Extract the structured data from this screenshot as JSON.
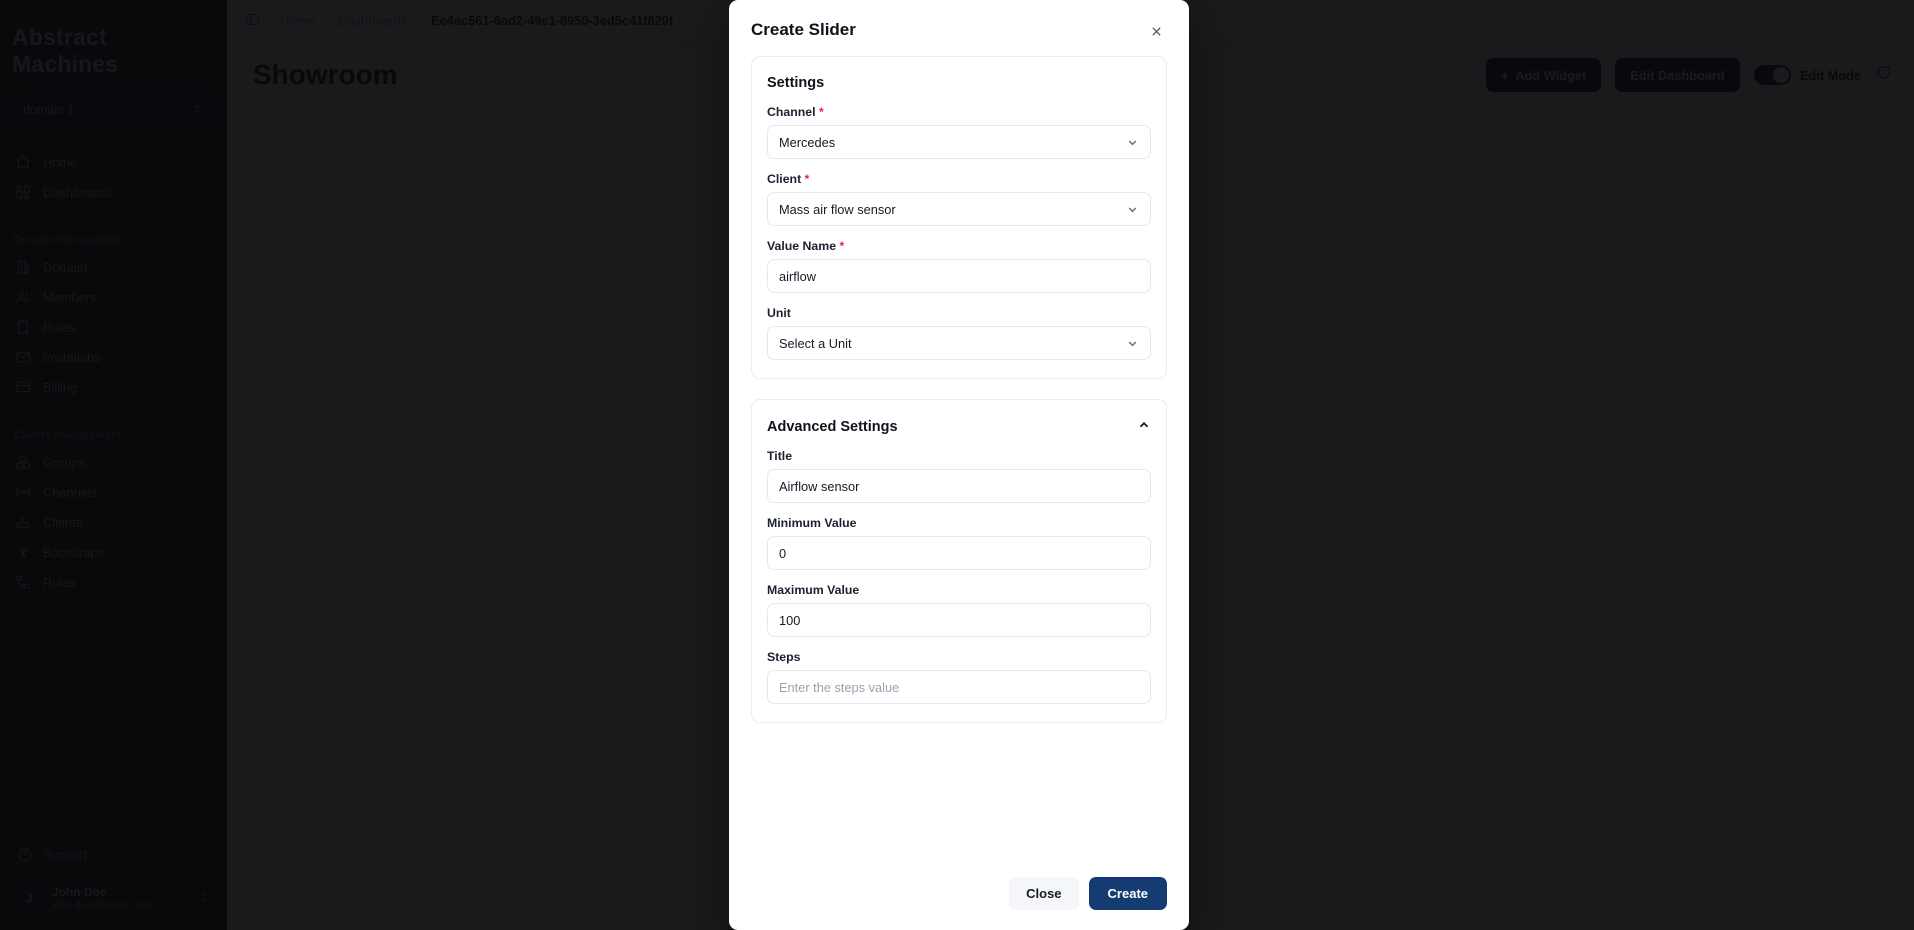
{
  "app": {
    "brand": "Abstract Machines",
    "domain_selector": {
      "value": "domain 1",
      "icon": "chevron-updown-icon"
    },
    "nav": {
      "main": [
        {
          "label": "Home",
          "icon": "home-icon"
        },
        {
          "label": "Dashboards",
          "icon": "grid-icon"
        }
      ],
      "domain_group_label": "Domain Management",
      "domain": [
        {
          "label": "Domain",
          "icon": "building-icon"
        },
        {
          "label": "Members",
          "icon": "users-icon"
        },
        {
          "label": "Roles",
          "icon": "book-icon"
        },
        {
          "label": "Invitations",
          "icon": "mail-icon"
        },
        {
          "label": "Billing",
          "icon": "credit-card-icon"
        }
      ],
      "clients_group_label": "Clients Management",
      "clients": [
        {
          "label": "Groups",
          "icon": "boxes-icon"
        },
        {
          "label": "Channels",
          "icon": "broadcast-icon"
        },
        {
          "label": "Clients",
          "icon": "router-icon"
        },
        {
          "label": "Bootstraps",
          "icon": "antenna-icon"
        },
        {
          "label": "Rules",
          "icon": "workflow-icon"
        }
      ]
    },
    "support": {
      "label": "Support",
      "icon": "help-circle-icon"
    },
    "user": {
      "initial": "J",
      "name": "John Doe",
      "email": "john.doe@email.com",
      "icon": "chevron-updown-icon"
    }
  },
  "topbar": {
    "panel_icon": "panel-toggle-icon",
    "breadcrumb": [
      "Home",
      "Dashboards",
      "Ee4ac561-6ad2-49e1-8950-3ed5c41f829f"
    ],
    "separator": "›"
  },
  "page": {
    "title": "Showroom",
    "add_widget_label": "Add Widget",
    "add_widget_icon": "plus-icon",
    "edit_dashboard_label": "Edit Dashboard",
    "edit_mode_label": "Edit Mode",
    "edit_mode_on": true,
    "refresh_icon": "refresh-icon"
  },
  "modal": {
    "title": "Create Slider",
    "close_icon": "close-icon",
    "settings": {
      "heading": "Settings",
      "fields": [
        {
          "label": "Channel",
          "required": true,
          "type": "select",
          "value": "Mercedes",
          "is_placeholder": false,
          "icon": "chevron-down-icon"
        },
        {
          "label": "Client",
          "required": true,
          "type": "select",
          "value": "Mass air flow sensor",
          "is_placeholder": false,
          "icon": "chevron-down-icon"
        },
        {
          "label": "Value Name",
          "required": true,
          "type": "text",
          "value": "airflow",
          "is_placeholder": false
        },
        {
          "label": "Unit",
          "required": false,
          "type": "select",
          "value": "Select a Unit",
          "is_placeholder": false,
          "icon": "chevron-down-icon"
        }
      ]
    },
    "advanced": {
      "heading": "Advanced Settings",
      "expanded": true,
      "collapse_icon": "chevron-up-icon",
      "fields": [
        {
          "label": "Title",
          "required": false,
          "type": "text",
          "value": "Airflow sensor",
          "is_placeholder": false
        },
        {
          "label": "Minimum Value",
          "required": false,
          "type": "number",
          "value": "0",
          "is_placeholder": false
        },
        {
          "label": "Maximum Value",
          "required": false,
          "type": "number",
          "value": "100",
          "is_placeholder": false
        },
        {
          "label": "Steps",
          "required": false,
          "type": "number",
          "value": "Enter the steps value",
          "is_placeholder": true
        }
      ]
    },
    "footer": {
      "close_label": "Close",
      "create_label": "Create"
    }
  },
  "colors": {
    "primary": "#143c73",
    "sidebar_bg": "#101217",
    "required_star": "#e0283a",
    "overlay": "rgba(8,9,11,0.93)"
  }
}
